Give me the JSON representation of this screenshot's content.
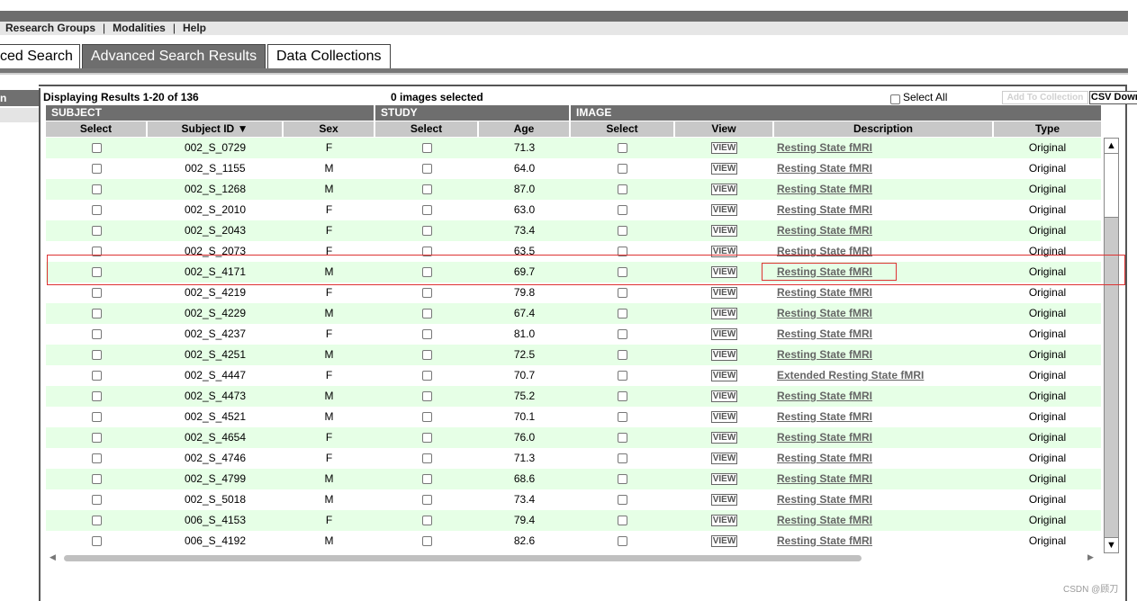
{
  "nav": {
    "items": [
      "Research Groups",
      "Modalities",
      "Help"
    ],
    "separator": "|"
  },
  "tabs": {
    "advanced_search": "ced Search",
    "results": "Advanced Search Results",
    "collections": "Data Collections"
  },
  "left_panel": {
    "header": "n"
  },
  "toolbar": {
    "displaying": "Displaying Results 1-20 of 136",
    "images_selected": "0 images selected",
    "select_all": "Select All",
    "add_to_collection": "Add To Collection",
    "csv_download": "CSV Download"
  },
  "table": {
    "groups": {
      "subject": "SUBJECT",
      "study": "STUDY",
      "image": "IMAGE"
    },
    "headers": {
      "subject_select": "Select",
      "subject_id": "Subject ID",
      "sex": "Sex",
      "study_select": "Select",
      "age": "Age",
      "image_select": "Select",
      "view": "View",
      "description": "Description",
      "type": "Type"
    },
    "sort_indicator": "▼",
    "view_label": "VIEW",
    "rows": [
      {
        "id": "002_S_0729",
        "sex": "F",
        "age": "71.3",
        "desc": "Resting State fMRI",
        "type": "Original"
      },
      {
        "id": "002_S_1155",
        "sex": "M",
        "age": "64.0",
        "desc": "Resting State fMRI",
        "type": "Original"
      },
      {
        "id": "002_S_1268",
        "sex": "M",
        "age": "87.0",
        "desc": "Resting State fMRI",
        "type": "Original"
      },
      {
        "id": "002_S_2010",
        "sex": "F",
        "age": "63.0",
        "desc": "Resting State fMRI",
        "type": "Original"
      },
      {
        "id": "002_S_2043",
        "sex": "F",
        "age": "73.4",
        "desc": "Resting State fMRI",
        "type": "Original"
      },
      {
        "id": "002_S_2073",
        "sex": "F",
        "age": "63.5",
        "desc": "Resting State fMRI",
        "type": "Original"
      },
      {
        "id": "002_S_4171",
        "sex": "M",
        "age": "69.7",
        "desc": "Resting State fMRI",
        "type": "Original"
      },
      {
        "id": "002_S_4219",
        "sex": "F",
        "age": "79.8",
        "desc": "Resting State fMRI",
        "type": "Original"
      },
      {
        "id": "002_S_4229",
        "sex": "M",
        "age": "67.4",
        "desc": "Resting State fMRI",
        "type": "Original"
      },
      {
        "id": "002_S_4237",
        "sex": "F",
        "age": "81.0",
        "desc": "Resting State fMRI",
        "type": "Original"
      },
      {
        "id": "002_S_4251",
        "sex": "M",
        "age": "72.5",
        "desc": "Resting State fMRI",
        "type": "Original"
      },
      {
        "id": "002_S_4447",
        "sex": "F",
        "age": "70.7",
        "desc": "Extended Resting State fMRI",
        "type": "Original"
      },
      {
        "id": "002_S_4473",
        "sex": "M",
        "age": "75.2",
        "desc": "Resting State fMRI",
        "type": "Original"
      },
      {
        "id": "002_S_4521",
        "sex": "M",
        "age": "70.1",
        "desc": "Resting State fMRI",
        "type": "Original"
      },
      {
        "id": "002_S_4654",
        "sex": "F",
        "age": "76.0",
        "desc": "Resting State fMRI",
        "type": "Original"
      },
      {
        "id": "002_S_4746",
        "sex": "F",
        "age": "71.3",
        "desc": "Resting State fMRI",
        "type": "Original"
      },
      {
        "id": "002_S_4799",
        "sex": "M",
        "age": "68.6",
        "desc": "Resting State fMRI",
        "type": "Original"
      },
      {
        "id": "002_S_5018",
        "sex": "M",
        "age": "73.4",
        "desc": "Resting State fMRI",
        "type": "Original"
      },
      {
        "id": "006_S_4153",
        "sex": "F",
        "age": "79.4",
        "desc": "Resting State fMRI",
        "type": "Original"
      },
      {
        "id": "006_S_4192",
        "sex": "M",
        "age": "82.6",
        "desc": "Resting State fMRI",
        "type": "Original"
      }
    ]
  },
  "scroll": {
    "up": "▲",
    "down": "▼",
    "left": "◀",
    "right": "▶"
  },
  "watermark": "CSDN @顾刀",
  "colors": {
    "row_alt": "#e6ffe6",
    "header_dark": "#6e6e6e",
    "highlight": "#dd3333"
  }
}
